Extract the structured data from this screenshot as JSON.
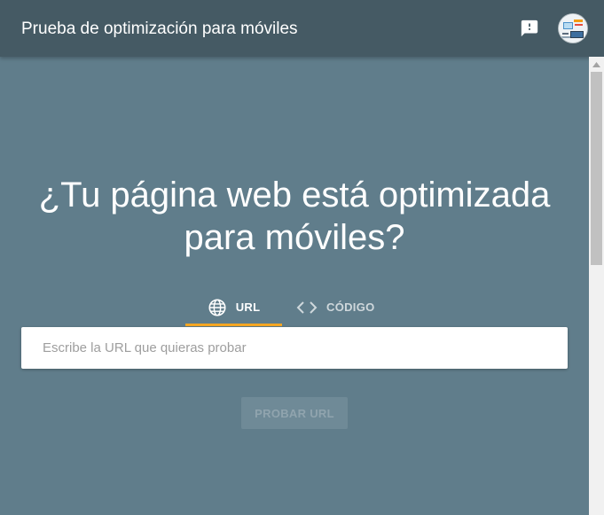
{
  "header": {
    "title": "Prueba de optimización para móviles",
    "feedback_icon": "feedback-icon",
    "avatar_icon": "avatar-icon"
  },
  "main": {
    "headline_line1": "¿Tu página web está optimizada",
    "headline_line2": "para móviles?",
    "tabs": [
      {
        "label": "URL",
        "icon": "globe-icon",
        "selected": true
      },
      {
        "label": "CÓDIGO",
        "icon": "code-icon",
        "selected": false
      }
    ],
    "url_input": {
      "placeholder": "Escribe la URL que quieras probar",
      "value": ""
    },
    "test_button": {
      "label": "PROBAR URL",
      "enabled": false
    }
  },
  "colors": {
    "app_bar": "#455a64",
    "background": "#607d8b",
    "tab_indicator": "#f5a623"
  }
}
